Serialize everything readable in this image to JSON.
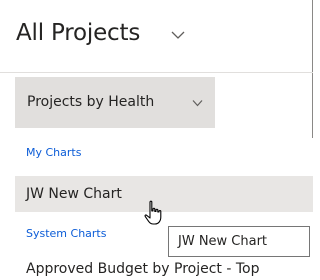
{
  "header": {
    "title": "All Projects",
    "title_chevron_icon": "chevron-down-icon"
  },
  "view_selector": {
    "label": "Projects by Health",
    "chevron_icon": "chevron-down-icon",
    "background": "#e1dfdd"
  },
  "dropdown": {
    "groups": [
      {
        "header": "My Charts",
        "items": [
          {
            "label": "JW New Chart",
            "hovered": true
          }
        ]
      },
      {
        "header": "System Charts",
        "items": [
          {
            "label": "Approved Budget by Project - Top"
          }
        ]
      }
    ]
  },
  "tooltip": {
    "text": "JW New Chart"
  },
  "cursor": {
    "icon": "hand-pointer-icon"
  },
  "colors": {
    "group_header": "#0b5cd7",
    "text": "#252423",
    "hover_background": "#e8e6e4"
  }
}
